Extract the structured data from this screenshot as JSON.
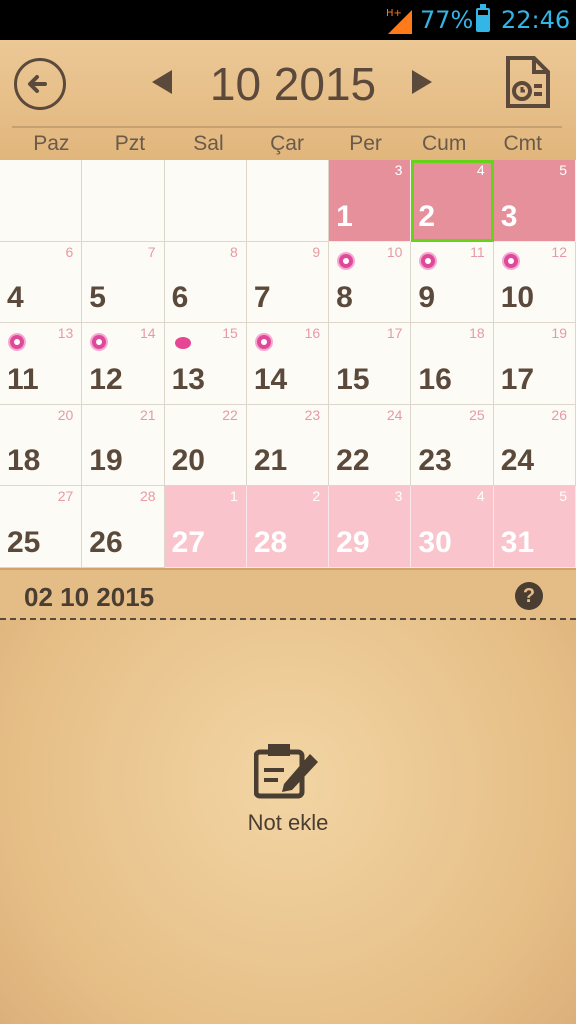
{
  "status_bar": {
    "network": "H+",
    "battery_percent": "77%",
    "battery_level": 0.77,
    "time": "22:46"
  },
  "header": {
    "month_year": "10 2015"
  },
  "weekdays": [
    "Paz",
    "Pzt",
    "Sal",
    "Çar",
    "Per",
    "Cum",
    "Cmt"
  ],
  "days": [
    {
      "num": "",
      "small": ""
    },
    {
      "num": "",
      "small": ""
    },
    {
      "num": "",
      "small": ""
    },
    {
      "num": "",
      "small": ""
    },
    {
      "num": "1",
      "small": "3",
      "state": "period"
    },
    {
      "num": "2",
      "small": "4",
      "state": "period selected"
    },
    {
      "num": "3",
      "small": "5",
      "state": "period"
    },
    {
      "num": "4",
      "small": "6"
    },
    {
      "num": "5",
      "small": "7"
    },
    {
      "num": "6",
      "small": "8"
    },
    {
      "num": "7",
      "small": "9"
    },
    {
      "num": "8",
      "small": "10",
      "marker": "flower"
    },
    {
      "num": "9",
      "small": "11",
      "marker": "flower"
    },
    {
      "num": "10",
      "small": "12",
      "marker": "flower"
    },
    {
      "num": "11",
      "small": "13",
      "marker": "flower"
    },
    {
      "num": "12",
      "small": "14",
      "marker": "flower"
    },
    {
      "num": "13",
      "small": "15",
      "marker": "egg"
    },
    {
      "num": "14",
      "small": "16",
      "marker": "flower"
    },
    {
      "num": "15",
      "small": "17"
    },
    {
      "num": "16",
      "small": "18"
    },
    {
      "num": "17",
      "small": "19"
    },
    {
      "num": "18",
      "small": "20"
    },
    {
      "num": "19",
      "small": "21"
    },
    {
      "num": "20",
      "small": "22"
    },
    {
      "num": "21",
      "small": "23"
    },
    {
      "num": "22",
      "small": "24"
    },
    {
      "num": "23",
      "small": "25"
    },
    {
      "num": "24",
      "small": "26"
    },
    {
      "num": "25",
      "small": "27"
    },
    {
      "num": "26",
      "small": "28"
    },
    {
      "num": "27",
      "small": "1",
      "state": "future"
    },
    {
      "num": "28",
      "small": "2",
      "state": "future"
    },
    {
      "num": "29",
      "small": "3",
      "state": "future"
    },
    {
      "num": "30",
      "small": "4",
      "state": "future"
    },
    {
      "num": "31",
      "small": "5",
      "state": "future"
    }
  ],
  "selected_date": "02 10 2015",
  "notes": {
    "add_label": "Not ekle"
  },
  "colors": {
    "period": "#e5909b",
    "future_period": "#f9c4cb",
    "selected_outline": "#66d21a",
    "text": "#5b4a3b"
  }
}
